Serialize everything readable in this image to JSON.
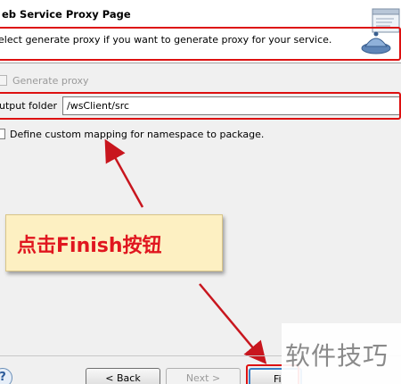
{
  "header": {
    "title": "eb Service Proxy Page",
    "description": "elect generate proxy if you want to generate proxy for your service."
  },
  "form": {
    "generate_proxy_label": "Generate proxy",
    "output_folder_label": "utput folder",
    "output_folder_value": "/wsClient/src",
    "custom_mapping_label": "Define custom mapping for namespace to package."
  },
  "annotation": {
    "callout_text": "点击Finish按钮"
  },
  "buttons": {
    "help": "?",
    "back": "< Back",
    "next": "Next >",
    "finish": "Fi"
  },
  "watermark": {
    "text": "软件技巧"
  },
  "colors": {
    "highlight_red": "#dd1111",
    "callout_bg": "#fdf0c2",
    "callout_text": "#e0161f"
  }
}
